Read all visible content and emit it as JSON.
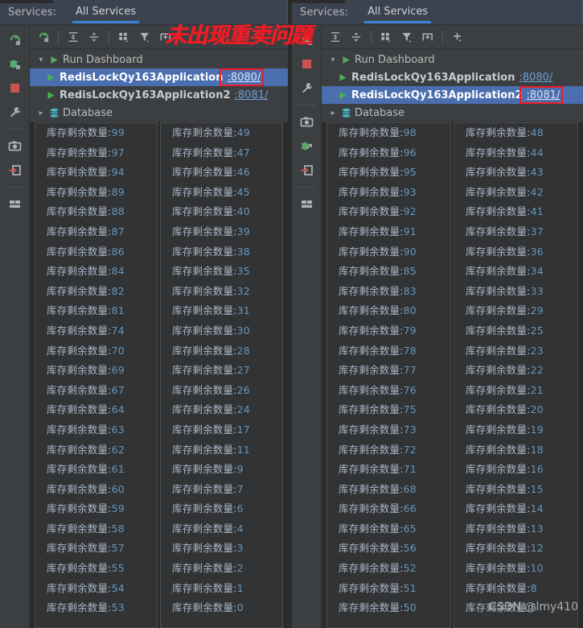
{
  "annotation": {
    "text": "未出现重卖问题",
    "color": "#ee1c25"
  },
  "watermark": {
    "text": "CSDN @lmy410"
  },
  "panels": [
    {
      "id": "left",
      "header": {
        "label": "Services:",
        "tab": "All Services"
      },
      "toolbar": {
        "icons": [
          {
            "name": "rerun-icon",
            "title": "Rerun"
          },
          {
            "name": "expand-all-icon",
            "title": "Expand All"
          },
          {
            "name": "collapse-all-icon",
            "title": "Collapse All"
          },
          {
            "name": "group-by-icon",
            "title": "Group By"
          },
          {
            "name": "filter-icon",
            "title": "Filter"
          },
          {
            "name": "add-tab-icon",
            "title": "Add Tab"
          }
        ]
      },
      "rail": {
        "icons": [
          {
            "name": "rerun-icon"
          },
          {
            "name": "debug-icon"
          },
          {
            "name": "stop-icon"
          },
          {
            "name": "settings-wrench-icon"
          },
          {
            "name": "camera-icon"
          },
          {
            "name": "export-icon"
          },
          {
            "name": "layout-icon"
          }
        ]
      },
      "tree": {
        "root": {
          "label": "Run Dashboard",
          "expanded": true
        },
        "apps": [
          {
            "label": "RedisLockQy163Application",
            "port": ":8080/",
            "selected": true,
            "highlighted": true
          },
          {
            "label": "RedisLockQy163Application2",
            "port": ":8081/",
            "selected": false,
            "highlighted": false
          }
        ],
        "database": {
          "label": "Database",
          "expanded": false
        }
      },
      "console": {
        "prefix": "库存剩余数量",
        "separator": ":",
        "columns": [
          {
            "values": [
              99,
              97,
              94,
              89,
              88,
              87,
              86,
              84,
              82,
              81,
              74,
              70,
              69,
              67,
              64,
              63,
              62,
              61,
              60,
              59,
              58,
              57,
              55,
              54,
              53
            ]
          },
          {
            "values": [
              49,
              47,
              46,
              45,
              40,
              39,
              38,
              35,
              32,
              31,
              30,
              28,
              27,
              26,
              24,
              17,
              11,
              9,
              7,
              6,
              4,
              3,
              2,
              1,
              0
            ]
          }
        ]
      }
    },
    {
      "id": "right",
      "header": {
        "label": "Services:",
        "tab": "All Services"
      },
      "toolbar": {
        "icons": [
          {
            "name": "expand-all-icon",
            "title": "Expand All"
          },
          {
            "name": "collapse-all-icon",
            "title": "Collapse All"
          },
          {
            "name": "group-by-icon",
            "title": "Group By"
          },
          {
            "name": "filter-icon",
            "title": "Filter"
          },
          {
            "name": "add-tab-icon",
            "title": "Add Tab"
          },
          {
            "name": "plus-icon",
            "title": "Add Service"
          }
        ]
      },
      "rail": {
        "icons": [
          {
            "name": "debug-icon"
          },
          {
            "name": "stop-icon"
          },
          {
            "name": "settings-wrench-icon"
          },
          {
            "name": "camera-icon"
          },
          {
            "name": "debug-attach-icon"
          },
          {
            "name": "export-icon"
          },
          {
            "name": "layout-icon"
          }
        ]
      },
      "tree": {
        "root": {
          "label": "Run Dashboard",
          "expanded": true
        },
        "apps": [
          {
            "label": "RedisLockQy163Application",
            "port": ":8080/",
            "selected": false,
            "highlighted": false
          },
          {
            "label": "RedisLockQy163Application2",
            "port": ":8081/",
            "selected": true,
            "highlighted": true
          }
        ],
        "database": {
          "label": "Database",
          "expanded": false
        }
      },
      "console": {
        "prefix": "库存剩余数量",
        "separator": ":",
        "columns": [
          {
            "values": [
              98,
              96,
              95,
              93,
              92,
              91,
              90,
              85,
              83,
              80,
              79,
              78,
              77,
              76,
              75,
              73,
              72,
              71,
              68,
              66,
              65,
              56,
              52,
              51,
              50
            ]
          },
          {
            "values": [
              48,
              44,
              43,
              42,
              41,
              37,
              36,
              34,
              33,
              29,
              25,
              23,
              22,
              21,
              20,
              19,
              18,
              16,
              15,
              14,
              13,
              12,
              10,
              8,
              5
            ]
          }
        ]
      }
    }
  ]
}
